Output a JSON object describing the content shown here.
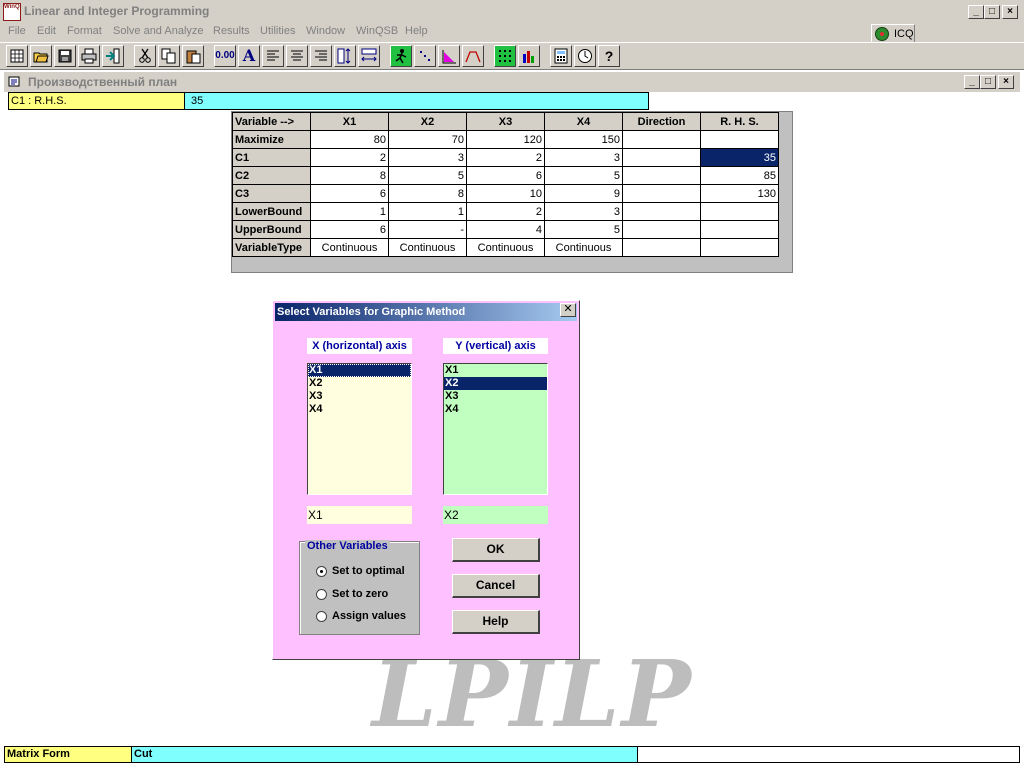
{
  "app": {
    "title": "Linear and Integer Programming",
    "icon_text": "WinQSB"
  },
  "menu": [
    "File",
    "Edit",
    "Format",
    "Solve and Analyze",
    "Results",
    "Utilities",
    "Window",
    "WinQSB",
    "Help"
  ],
  "icq": {
    "label": "ICQ"
  },
  "toolbar": {
    "buttons": [
      "new-icon",
      "open-icon",
      "save-icon",
      "print-icon",
      "exit-icon",
      "cut-icon",
      "copy-icon",
      "paste-icon",
      "number-format-icon",
      "font-icon",
      "align-left-icon",
      "align-center-icon",
      "align-right-icon",
      "row-height-icon",
      "column-width-icon",
      "solve-icon",
      "graph-scatter-icon",
      "graphic-method-icon",
      "range-icon",
      "matrix-form-icon",
      "chart-icon",
      "calculator-icon",
      "clock-icon",
      "help-icon"
    ],
    "number_label": "0.00",
    "font_label": "A"
  },
  "document": {
    "title": "Производственный план",
    "cell_label": "C1 : R.H.S.",
    "cell_value": "35"
  },
  "grid": {
    "headers": [
      "Variable -->",
      "X1",
      "X2",
      "X3",
      "X4",
      "Direction",
      "R. H. S."
    ],
    "rows": [
      [
        "Maximize",
        "80",
        "70",
        "120",
        "150",
        "",
        ""
      ],
      [
        "C1",
        "2",
        "3",
        "2",
        "3",
        "",
        "35"
      ],
      [
        "C2",
        "8",
        "5",
        "6",
        "5",
        "",
        "85"
      ],
      [
        "C3",
        "6",
        "8",
        "10",
        "9",
        "",
        "130"
      ],
      [
        "LowerBound",
        "1",
        "1",
        "2",
        "3",
        "",
        ""
      ],
      [
        "UpperBound",
        "6",
        "-",
        "4",
        "5",
        "",
        ""
      ],
      [
        "VariableType",
        "Continuous",
        "Continuous",
        "Continuous",
        "Continuous",
        "",
        ""
      ]
    ]
  },
  "watermark": "LPILP",
  "dialog": {
    "title": "Select Variables for Graphic Method",
    "x_axis_label": "X (horizontal) axis",
    "y_axis_label": "Y (vertical) axis",
    "x_items": [
      "X1",
      "X2",
      "X3",
      "X4"
    ],
    "y_items": [
      "X1",
      "X2",
      "X3",
      "X4"
    ],
    "x_selected": "X1",
    "y_selected": "X2",
    "other_title": "Other Variables",
    "radios": [
      "Set to optimal",
      "Set to zero",
      "Assign values"
    ],
    "radio_checked": "Set to optimal",
    "ok": "OK",
    "cancel": "Cancel",
    "help": "Help",
    "colors": {
      "panel": "#ffc0ff",
      "x_list": "#ffffe0",
      "y_list": "#c0ffc0",
      "x_value_bg": "#ffffe0",
      "y_value_bg": "#c0ffc0"
    }
  },
  "status": {
    "left": "Matrix Form",
    "middle": "Cut"
  }
}
